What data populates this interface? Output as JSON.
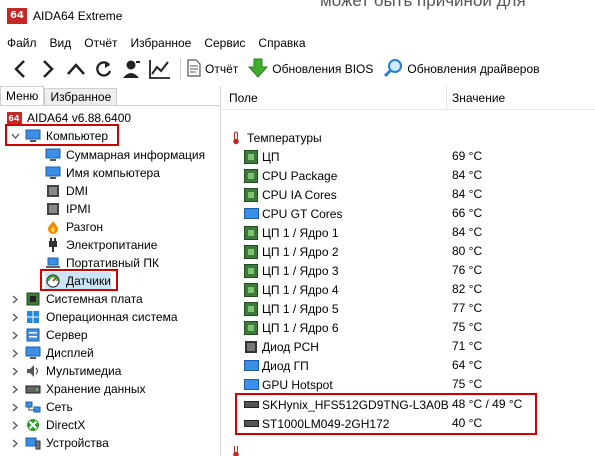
{
  "window": {
    "app_icon_text": "64",
    "title": "AIDA64 Extreme",
    "background_text": "может быть причиной для"
  },
  "menubar": [
    "Файл",
    "Вид",
    "Отчёт",
    "Избранное",
    "Сервис",
    "Справка"
  ],
  "toolbar": {
    "report_label": "Отчёт",
    "bios_label": "Обновления BIOS",
    "drivers_label": "Обновления драйверов"
  },
  "left_panel": {
    "tabs": [
      "Меню",
      "Избранное"
    ],
    "root": "AIDA64 v6.88.6400",
    "computer": "Компьютер",
    "computer_children": [
      "Суммарная информация",
      "Имя компьютера",
      "DMI",
      "IPMI",
      "Разгон",
      "Электропитание",
      "Портативный ПК",
      "Датчики"
    ],
    "categories": [
      "Системная плата",
      "Операционная система",
      "Сервер",
      "Дисплей",
      "Мультимедиа",
      "Хранение данных",
      "Сеть",
      "DirectX",
      "Устройства"
    ]
  },
  "right_panel": {
    "col_field": "Поле",
    "col_value": "Значение",
    "section": "Температуры",
    "rows": [
      {
        "name": "ЦП",
        "value": "69 °C",
        "icon": "chip-icon"
      },
      {
        "name": "CPU Package",
        "value": "84 °C",
        "icon": "chip-icon"
      },
      {
        "name": "CPU IA Cores",
        "value": "84 °C",
        "icon": "chip-icon"
      },
      {
        "name": "CPU GT Cores",
        "value": "66 °C",
        "icon": "monitor-icon"
      },
      {
        "name": "ЦП 1 / Ядро 1",
        "value": "84 °C",
        "icon": "chip-icon"
      },
      {
        "name": "ЦП 1 / Ядро 2",
        "value": "80 °C",
        "icon": "chip-icon"
      },
      {
        "name": "ЦП 1 / Ядро 3",
        "value": "76 °C",
        "icon": "chip-icon"
      },
      {
        "name": "ЦП 1 / Ядро 4",
        "value": "82 °C",
        "icon": "chip-icon"
      },
      {
        "name": "ЦП 1 / Ядро 5",
        "value": "77 °C",
        "icon": "chip-icon"
      },
      {
        "name": "ЦП 1 / Ядро 6",
        "value": "75 °C",
        "icon": "chip-icon"
      },
      {
        "name": "Диод PCH",
        "value": "71 °C",
        "icon": "board-icon"
      },
      {
        "name": "Диод ГП",
        "value": "64 °C",
        "icon": "monitor-icon"
      },
      {
        "name": "GPU Hotspot",
        "value": "75 °C",
        "icon": "monitor-icon"
      },
      {
        "name": "SKHynix_HFS512GD9TNG-L3A0B",
        "value": "48 °C / 49 °C",
        "icon": "drive-icon"
      },
      {
        "name": "ST1000LM049-2GH172",
        "value": "40 °C",
        "icon": "drive-icon"
      }
    ]
  },
  "colors": {
    "highlight_box": "#d10000",
    "chip": "#3d7a3a",
    "monitor": "#3a8ee6",
    "app_icon": "#c62828"
  }
}
